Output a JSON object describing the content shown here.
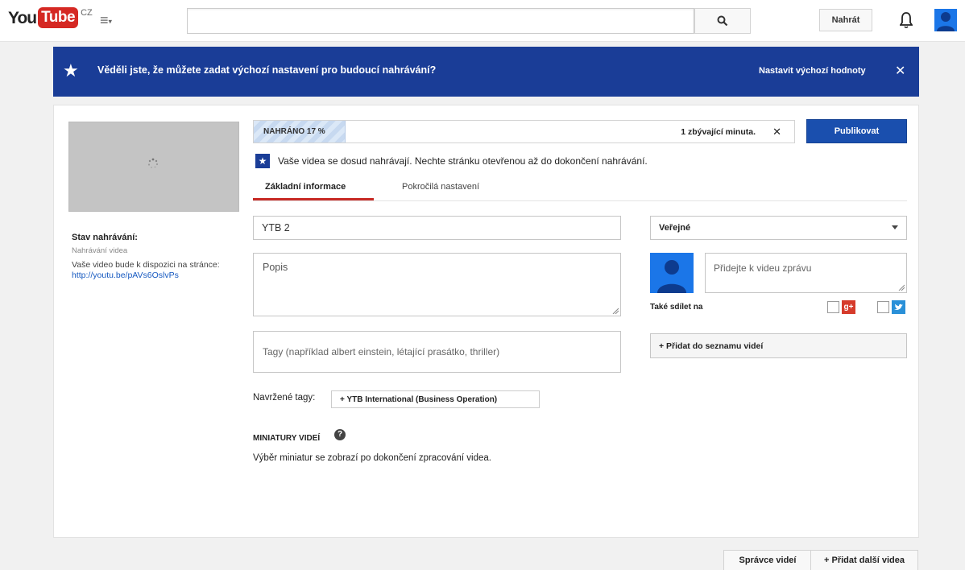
{
  "header": {
    "logo_you": "You",
    "logo_tube": "Tube",
    "logo_country": "CZ",
    "guide_symbol": "≡",
    "upload_label": "Nahrát",
    "search_placeholder": ""
  },
  "banner": {
    "text": "Věděli jste, že můžete zadat výchozí nastavení pro budoucí nahrávání?",
    "link": "Nastavit výchozí hodnoty",
    "close": "✕"
  },
  "status": {
    "title": "Stav nahrávání:",
    "subtitle": "Nahrávání videa",
    "desc_prefix": "Vaše video bude k dispozici na stránce:",
    "url": "http://youtu.be/pAVs6OslvPs"
  },
  "progress": {
    "label": "NAHRÁNO 17 %",
    "percent": 17,
    "remaining": "1 zbývající minuta.",
    "cancel": "✕"
  },
  "publish_label": "Publikovat",
  "notice": "Vaše videa se dosud nahrávají. Nechte stránku otevřenou až do dokončení nahrávání.",
  "tabs": [
    {
      "label": "Základní informace",
      "active": true
    },
    {
      "label": "Pokročilá nastavení",
      "active": false
    }
  ],
  "form": {
    "title_value": "YTB 2",
    "description_placeholder": "Popis",
    "tags_placeholder": "Tagy (například albert einstein, létající prasátko, thriller)",
    "suggested_label": "Navržené tagy:",
    "suggested_tag": "+ YTB International (Business Operation)",
    "thumbnails_heading": "MINIATURY VIDEÍ",
    "thumbnails_text": "Výběr miniatur se zobrazí po dokončení zpracování videa."
  },
  "sidebar_right": {
    "privacy_value": "Veřejné",
    "share_placeholder": "Přidejte k videu zprávu",
    "also_share_label": "Také sdílet na",
    "playlist_label": "+ Přidat do seznamu videí"
  },
  "footer": {
    "manage_label": "Správce videí",
    "add_more_label": "+ Přidat další videa"
  },
  "colors": {
    "banner": "#1a3d97",
    "publish": "#1a4fae",
    "tab_active": "#c72a25",
    "logo_red": "#d52823"
  }
}
